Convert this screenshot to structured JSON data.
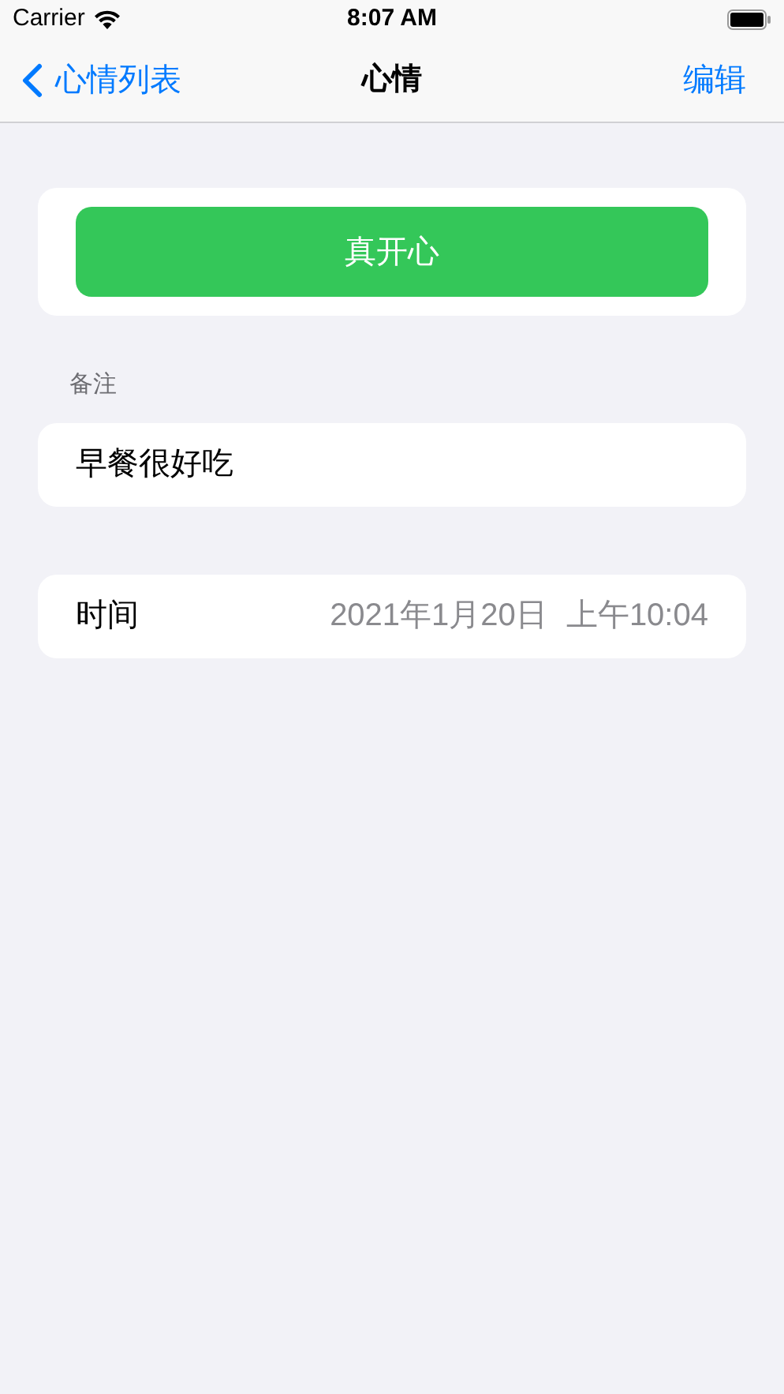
{
  "status_bar": {
    "carrier": "Carrier",
    "time": "8:07 AM"
  },
  "nav_bar": {
    "back_label": "心情列表",
    "title": "心情",
    "action": "编辑"
  },
  "mood_button": {
    "label": "真开心"
  },
  "note": {
    "header": "备注",
    "value": "早餐很好吃"
  },
  "time_row": {
    "label": "时间",
    "date": "2021年1月20日",
    "time": "上午10:04"
  }
}
